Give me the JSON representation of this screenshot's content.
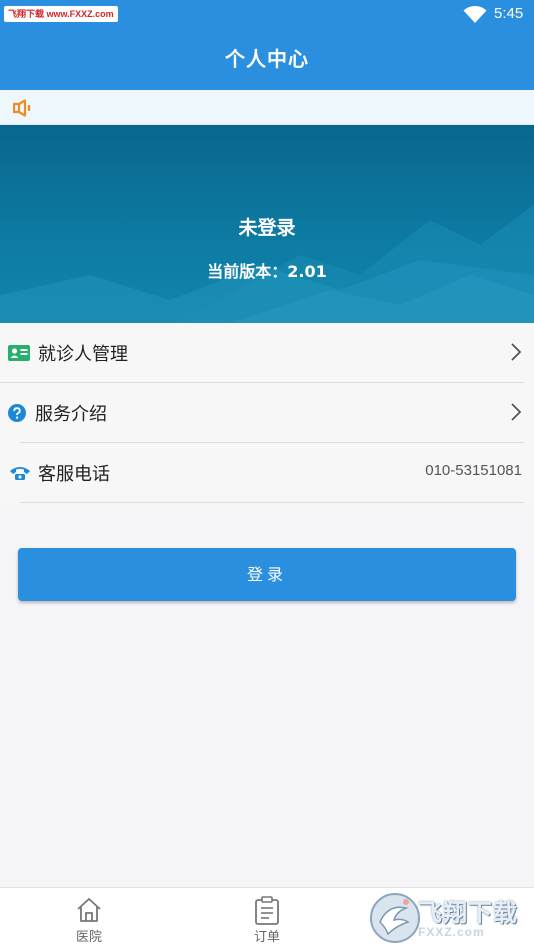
{
  "status_bar": {
    "watermark": "飞翔下载 www.FXXZ.com",
    "time": "5:45"
  },
  "header": {
    "title": "个人中心"
  },
  "notice": {
    "icon": "speaker-icon"
  },
  "profile": {
    "login_status": "未登录",
    "version_text": "当前版本：2.01"
  },
  "menu": {
    "items": [
      {
        "label": "就诊人管理",
        "icon": "id-card-icon",
        "has_arrow": true
      },
      {
        "label": "服务介绍",
        "icon": "question-icon",
        "has_arrow": true
      },
      {
        "label": "客服电话",
        "icon": "phone-icon",
        "value": "010-53151081"
      }
    ]
  },
  "login_button": {
    "label": "登录"
  },
  "tabbar": {
    "tabs": [
      {
        "label": "医院",
        "icon": "home-icon"
      },
      {
        "label": "订单",
        "icon": "clipboard-icon"
      }
    ]
  },
  "brand": {
    "name": "飞翔下载",
    "url": "FXXZ.com"
  },
  "colors": {
    "primary": "#2a8fdf",
    "banner": "#0d7aa2",
    "notice_icon": "#f08a24",
    "icon_green": "#27b06c",
    "icon_blue": "#1e88d6"
  }
}
